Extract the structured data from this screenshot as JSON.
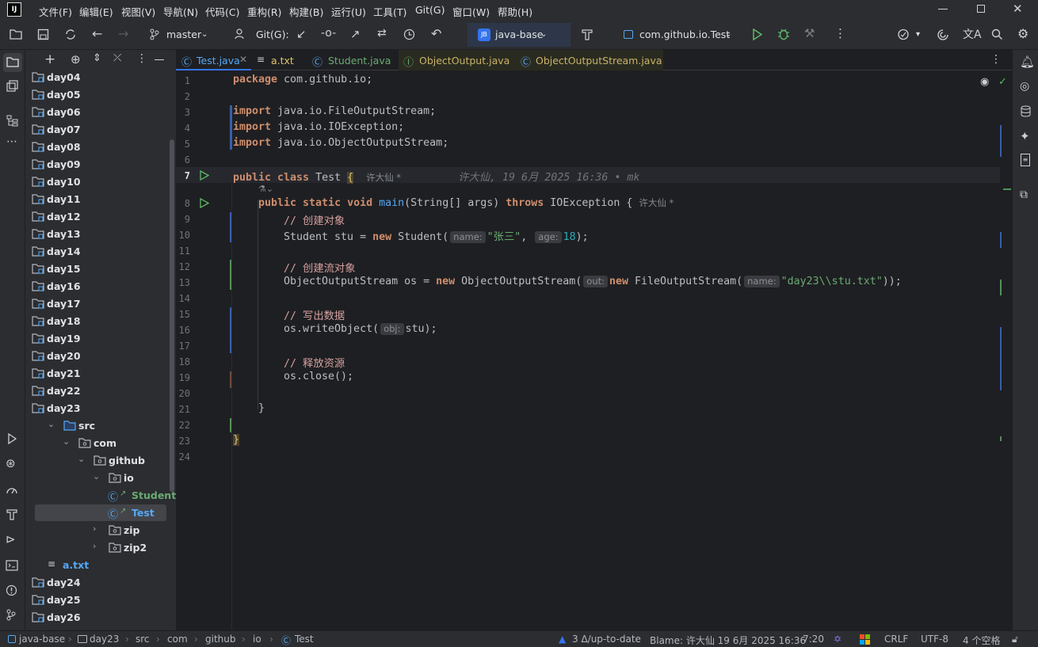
{
  "titlebar": {
    "logo": "IJ",
    "menu": [
      "文件(F)",
      "编辑(E)",
      "视图(V)",
      "导航(N)",
      "代码(C)",
      "重构(R)",
      "构建(B)",
      "运行(U)",
      "工具(T)",
      "Git(G)",
      "窗口(W)",
      "帮助(H)"
    ]
  },
  "toolbar": {
    "branch": "master",
    "git_label": "Git(G):",
    "project_badge": "JB",
    "project": "java-base",
    "run_config": "com.github.io.Test"
  },
  "tree": [
    {
      "label": "day04",
      "kind": "folder"
    },
    {
      "label": "day05",
      "kind": "folder"
    },
    {
      "label": "day06",
      "kind": "folder"
    },
    {
      "label": "day07",
      "kind": "folder"
    },
    {
      "label": "day08",
      "kind": "folder"
    },
    {
      "label": "day09",
      "kind": "folder"
    },
    {
      "label": "day10",
      "kind": "folder"
    },
    {
      "label": "day11",
      "kind": "folder"
    },
    {
      "label": "day12",
      "kind": "folder"
    },
    {
      "label": "day13",
      "kind": "folder"
    },
    {
      "label": "day14",
      "kind": "folder"
    },
    {
      "label": "day15",
      "kind": "folder"
    },
    {
      "label": "day16",
      "kind": "folder"
    },
    {
      "label": "day17",
      "kind": "folder"
    },
    {
      "label": "day18",
      "kind": "folder"
    },
    {
      "label": "day19",
      "kind": "folder"
    },
    {
      "label": "day20",
      "kind": "folder"
    },
    {
      "label": "day21",
      "kind": "folder"
    },
    {
      "label": "day22",
      "kind": "folder"
    },
    {
      "label": "day23",
      "kind": "folder"
    },
    {
      "label": "src",
      "kind": "src"
    },
    {
      "label": "com",
      "kind": "pkg"
    },
    {
      "label": "github",
      "kind": "pkg"
    },
    {
      "label": "io",
      "kind": "pkg"
    },
    {
      "label": "Student",
      "kind": "class"
    },
    {
      "label": "Test",
      "kind": "class"
    },
    {
      "label": "zip",
      "kind": "pkg"
    },
    {
      "label": "zip2",
      "kind": "pkg"
    },
    {
      "label": "a.txt",
      "kind": "txt"
    },
    {
      "label": "day24",
      "kind": "folder"
    },
    {
      "label": "day25",
      "kind": "folder"
    },
    {
      "label": "day26",
      "kind": "folder"
    }
  ],
  "tabs": [
    "Test.java",
    "a.txt",
    "Student.java",
    "ObjectOutput.java",
    "ObjectOutputStream.java"
  ],
  "line_numbers": [
    "1",
    "2",
    "3",
    "4",
    "5",
    "6",
    "7",
    "8",
    "9",
    "10",
    "11",
    "12",
    "13",
    "14",
    "15",
    "16",
    "17",
    "18",
    "19",
    "20",
    "21",
    "22",
    "23",
    "24"
  ],
  "code": {
    "l1_kw": "package",
    "l1_rest": " com.github.io;",
    "l3_kw": "import",
    "l3_rest": " java.io.FileOutputStream;",
    "l4_kw": "import",
    "l4_rest": " java.io.IOException;",
    "l5_kw": "import",
    "l5_rest": " java.io.ObjectOutputStream;",
    "l7_kw": "public class",
    "l7_name": " Test ",
    "l7_brace": "{",
    "l7_author": "许大仙 *",
    "l7_blame": "许大仙, 19 6月 2025 16:36 • mk",
    "l8_kw": "public static void",
    "l8_fn": "main",
    "l8_params": "(String[] args) ",
    "l8_throws": "throws",
    "l8_rest": " IOException {",
    "l8_author": "许大仙 *",
    "l9_comment": "// 创建对象",
    "l10_a": "Student stu = ",
    "l10_new": "new",
    "l10_b": " Student(",
    "l10_hint1": "name:",
    "l10_str": "\"张三\"",
    "l10_c": ", ",
    "l10_hint2": "age:",
    "l10_num": "18",
    "l10_d": ");",
    "l12_comment": "// 创建流对象",
    "l13_a": "ObjectOutputStream os = ",
    "l13_new1": "new",
    "l13_b": " ObjectOutputStream(",
    "l13_hint1": "out:",
    "l13_new2": "new",
    "l13_c": " FileOutputStream(",
    "l13_hint2": "name:",
    "l13_str": "\"day23\\\\stu.txt\"",
    "l13_d": "));",
    "l15_comment": "// 写出数据",
    "l16_a": "os.writeObject(",
    "l16_hint": "obj:",
    "l16_b": "stu);",
    "l18_comment": "// 释放资源",
    "l19": "os.close();",
    "l21": "}",
    "l23": "}"
  },
  "status": {
    "crumbs": [
      "java-base",
      "day23",
      "src",
      "com",
      "github",
      "io",
      "Test"
    ],
    "vcs": "3 Δ/up-to-date",
    "blame": "Blame: 许大仙 19 6月 2025 16:36",
    "pos": "7:20",
    "eol": "CRLF",
    "enc": "UTF-8",
    "indent": "4 个空格"
  },
  "colors": {
    "accent": "#3574f0",
    "keyword": "#cf8e6d",
    "string": "#6aab73",
    "comment": "#d5a0a0",
    "added": "#549159",
    "modified": "#375fad"
  }
}
